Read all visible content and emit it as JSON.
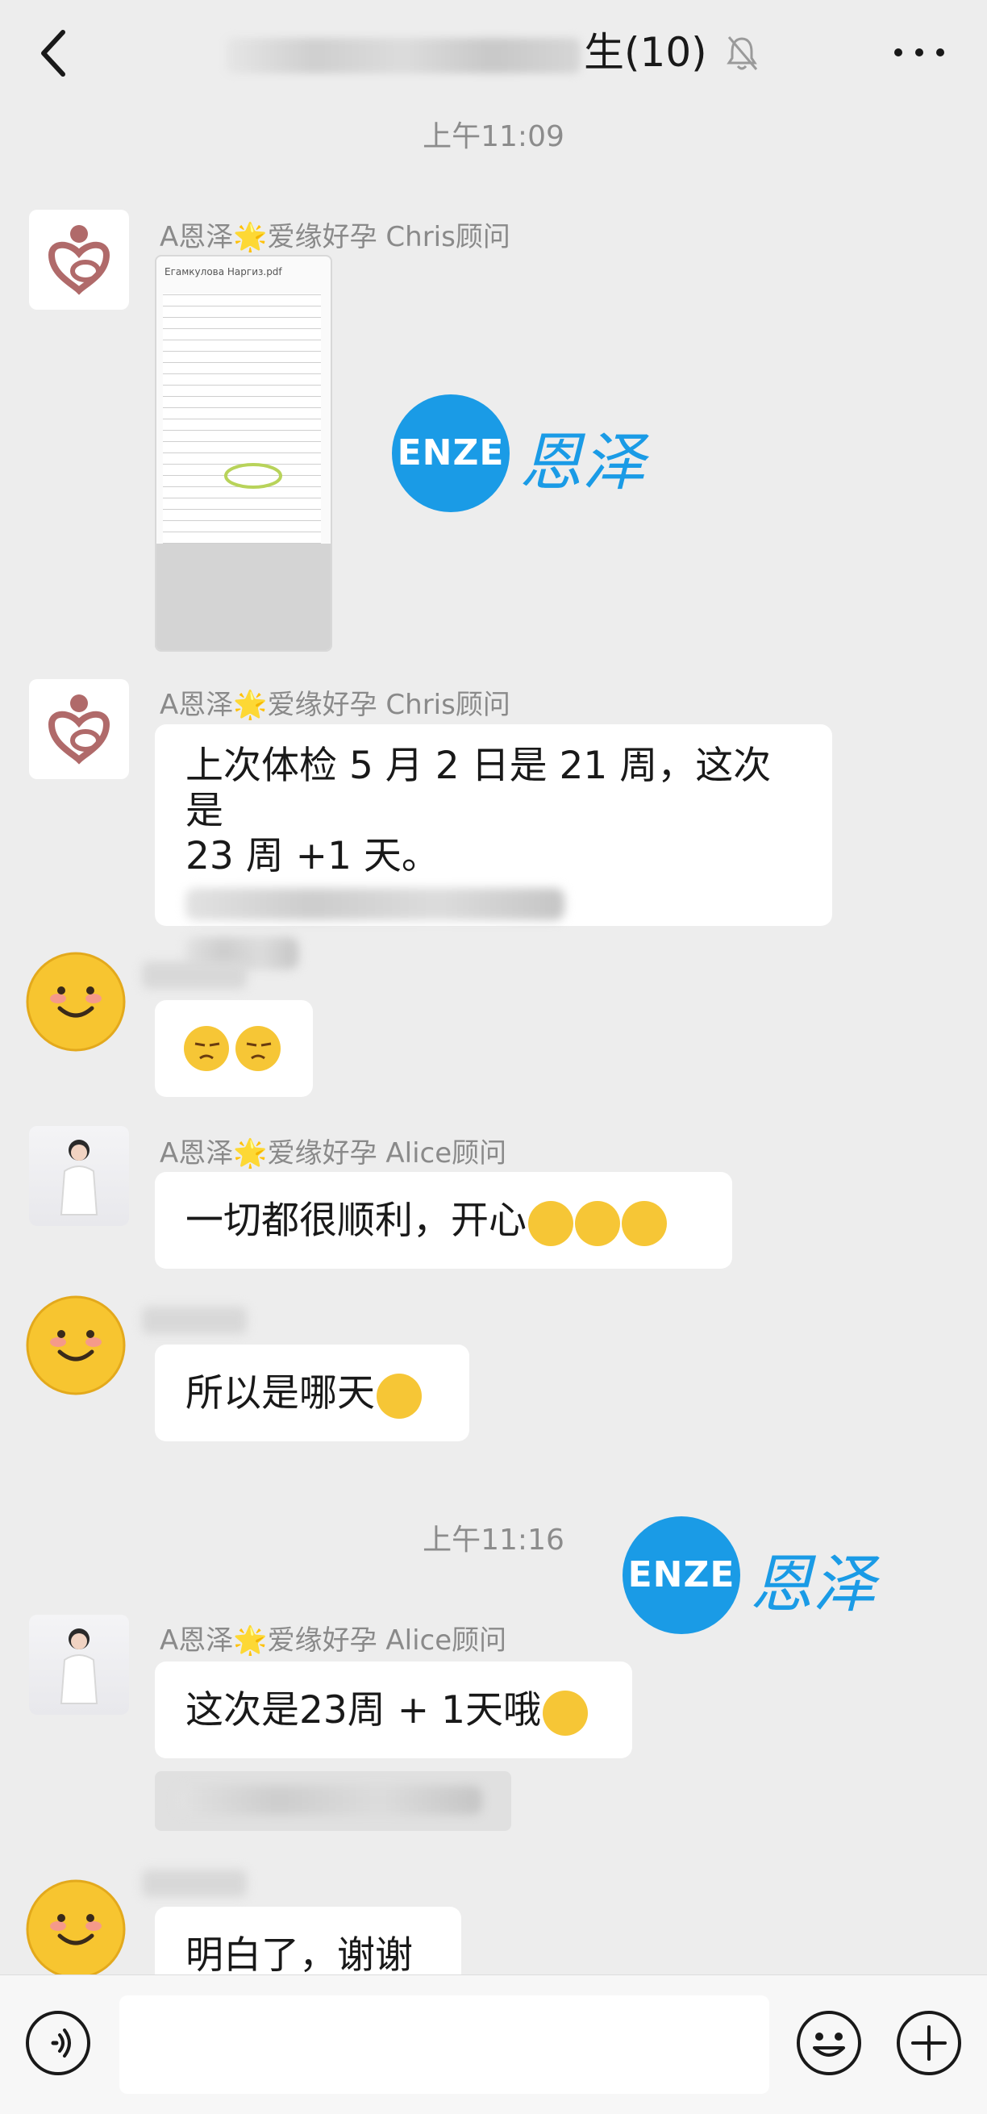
{
  "header": {
    "title_suffix": "生(10)"
  },
  "timestamps": [
    "上午11:09",
    "上午11:16"
  ],
  "watermark": {
    "latin": "ENZE",
    "chinese": "恩泽"
  },
  "messages": [
    {
      "sender": "A恩泽🌟爱缘好孕 Chris顾问",
      "type": "image",
      "caption": "Егамкулова Наргиз.pdf"
    },
    {
      "sender": "A恩泽🌟爱缘好孕 Chris顾问",
      "type": "text",
      "line1": "上次体检 5 月 2 日是 21 周，这次是",
      "line2": "23 周 +1 天。"
    },
    {
      "sender": "",
      "type": "emoji"
    },
    {
      "sender": "A恩泽🌟爱缘好孕 Alice顾问",
      "type": "text",
      "text": "一切都很顺利，开心"
    },
    {
      "sender": "",
      "type": "text",
      "text": "所以是哪天"
    },
    {
      "sender": "A恩泽🌟爱缘好孕 Alice顾问",
      "type": "text",
      "text": "这次是23周 + 1天哦"
    },
    {
      "sender": "",
      "type": "text",
      "text": "明白了，谢谢"
    }
  ],
  "icons": {
    "back": "chevron-left-icon",
    "mute": "bell-off-icon",
    "more": "more-icon",
    "voice": "voice-icon",
    "emoji": "emoji-icon",
    "plus": "plus-icon"
  }
}
